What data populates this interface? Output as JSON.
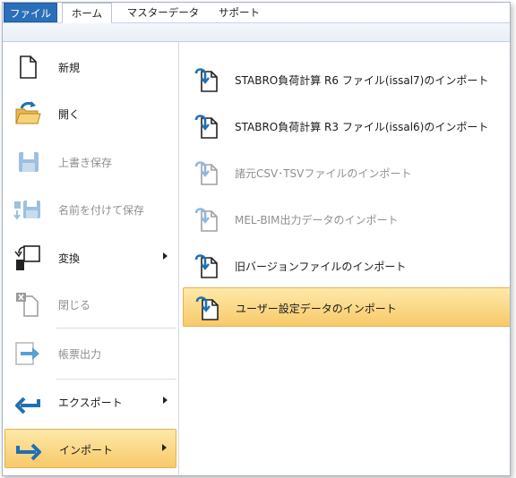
{
  "tabs": {
    "file": "ファイル",
    "home": "ホーム",
    "master": "マスターデータ",
    "support": "サポート"
  },
  "left_menu": [
    {
      "label": "新規",
      "icon": "new-document-icon",
      "enabled": true
    },
    {
      "label": "開く",
      "icon": "open-folder-icon",
      "enabled": true
    },
    {
      "label": "上書き保存",
      "icon": "save-icon",
      "enabled": false
    },
    {
      "label": "名前を付けて保存",
      "icon": "save-as-icon",
      "enabled": false
    },
    {
      "label": "変換",
      "icon": "convert-icon",
      "enabled": true,
      "submenu": true
    },
    {
      "label": "閉じる",
      "icon": "close-document-icon",
      "enabled": false
    },
    {
      "label": "帳票出力",
      "icon": "report-output-icon",
      "enabled": false
    },
    {
      "label": "エクスポート",
      "icon": "export-icon",
      "enabled": true,
      "submenu": true
    },
    {
      "label": "インポート",
      "icon": "import-icon",
      "enabled": true,
      "submenu": true,
      "selected": true
    }
  ],
  "import_submenu": [
    {
      "label": "STABRO負荷計算 R6 ファイル(issal7)のインポート",
      "enabled": true
    },
    {
      "label": "STABRO負荷計算 R3 ファイル(issal6)のインポート",
      "enabled": true
    },
    {
      "label": "諸元CSV･TSVファイルのインポート",
      "enabled": false
    },
    {
      "label": "MEL-BIM出力データのインポート",
      "enabled": false
    },
    {
      "label": "旧バージョンファイルのインポート",
      "enabled": true
    },
    {
      "label": "ユーザー設定データのインポート",
      "enabled": true,
      "hovered": true
    }
  ],
  "colors": {
    "file_tab": "#2c6fb9",
    "highlight": "#f8c96a",
    "import_arrow": "#1f6fb4",
    "disabled_text": "#8f8f8f"
  }
}
